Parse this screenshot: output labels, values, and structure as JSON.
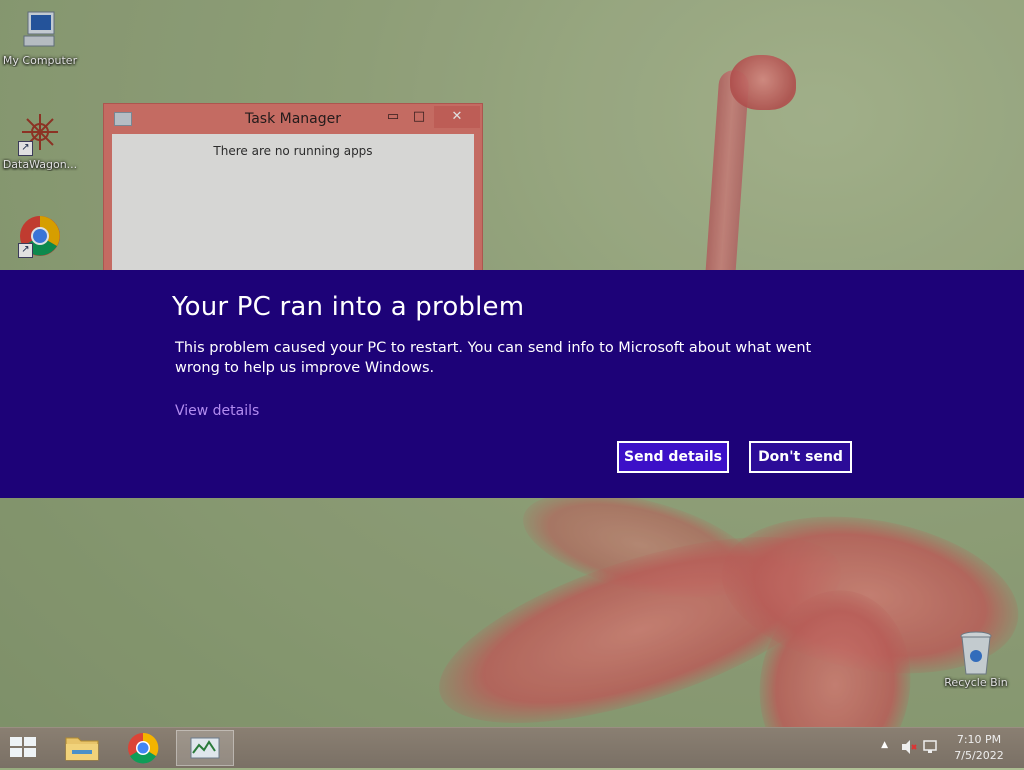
{
  "desktop": {
    "icons": [
      {
        "label": "My Computer"
      },
      {
        "label": "DataWagon..."
      },
      {
        "label": ""
      },
      {
        "label": "Recycle Bin"
      }
    ]
  },
  "task_manager": {
    "title": "Task Manager",
    "minimize_glyph": "▭",
    "maximize_glyph": "□",
    "close_glyph": "✕",
    "empty_message": "There are no running apps"
  },
  "error_dialog": {
    "title": "Your PC ran into a problem",
    "message": "This problem caused your PC to restart. You can send info to Microsoft about what went wrong to help us improve Windows.",
    "view_details_label": "View details",
    "send_details_label": "Send details",
    "dont_send_label": "Don't send",
    "background_color": "#1d0278"
  },
  "taskbar": {
    "apps": [
      "windows-start-icon",
      "file-explorer-icon",
      "chrome-icon",
      "task-manager-icon"
    ],
    "tray": {
      "show_hidden_glyph": "▲",
      "time": "7:10 PM",
      "date": "7/5/2022"
    }
  }
}
